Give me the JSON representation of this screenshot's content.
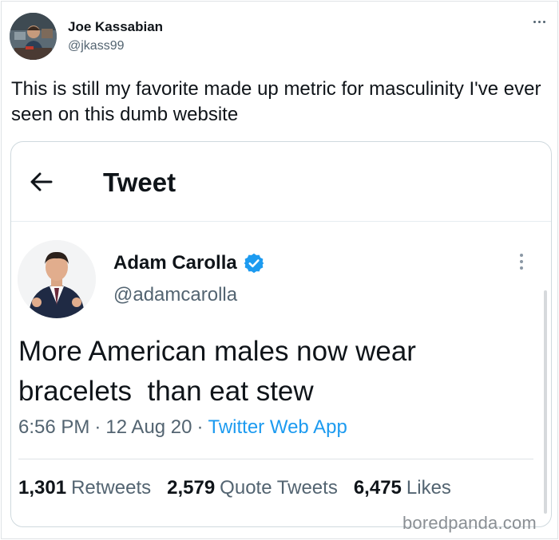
{
  "outer_tweet": {
    "author_name": "Joe Kassabian",
    "author_handle": "@jkass99",
    "text": "This is still my favorite made up metric for masculinity I've ever seen on this dumb website",
    "more_icon": "more-horizontal-icon"
  },
  "embedded_tweet": {
    "header_title": "Tweet",
    "back_icon": "back-arrow-icon",
    "author_name": "Adam Carolla",
    "verified_icon": "verified-badge-icon",
    "author_handle": "@adamcarolla",
    "text": "More American males now wear bracelets  than eat stew",
    "time": "6:56 PM",
    "date": "12 Aug 20",
    "source": "Twitter Web App",
    "separator": "·",
    "stats": [
      {
        "count": "1,301",
        "label": "Retweets"
      },
      {
        "count": "2,579",
        "label": "Quote Tweets"
      },
      {
        "count": "6,475",
        "label": "Likes"
      }
    ]
  },
  "watermark": "boredpanda.com",
  "colors": {
    "link": "#1d9bf0",
    "secondary_text": "#536471",
    "primary_text": "#0f1419"
  }
}
